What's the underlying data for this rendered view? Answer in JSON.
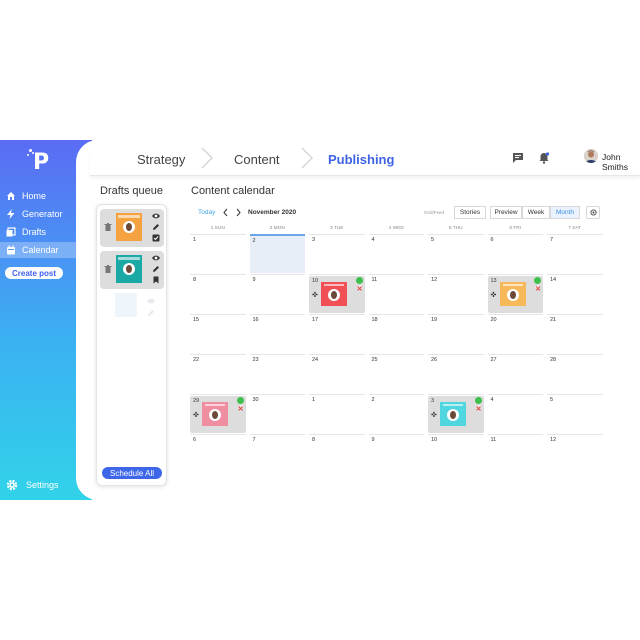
{
  "sidebar": {
    "items": [
      {
        "label": "Home",
        "icon": "home-icon"
      },
      {
        "label": "Generator",
        "icon": "bolt-icon"
      },
      {
        "label": "Drafts",
        "icon": "drafts-icon"
      },
      {
        "label": "Calendar",
        "icon": "calendar-icon"
      }
    ],
    "create_label": "Create post",
    "settings_label": "Settings",
    "active": "Calendar"
  },
  "header": {
    "breadcrumbs": [
      "Strategy",
      "Content",
      "Publishing"
    ],
    "active_crumb": "Publishing",
    "username": "John Smiths"
  },
  "drafts": {
    "title": "Drafts queue",
    "schedule_label": "Schedule All"
  },
  "calendar": {
    "title": "Content calendar",
    "today_label": "Today",
    "month": "November 2020",
    "filter_label": "Grid/Feed",
    "stories_label": "Stories",
    "views": [
      "Preview",
      "Week",
      "Month"
    ],
    "selected_view": "Month",
    "day_headers": [
      "1 SUN",
      "2 MON",
      "3 TUE",
      "4 WED",
      "5 THU",
      "6 FRI",
      "7 SAT"
    ],
    "weeks": [
      [
        "1",
        "2",
        "3",
        "4",
        "5",
        "6",
        "7"
      ],
      [
        "8",
        "9",
        "10",
        "11",
        "12",
        "13",
        "14"
      ],
      [
        "15",
        "16",
        "17",
        "18",
        "19",
        "20",
        "21"
      ],
      [
        "22",
        "23",
        "24",
        "25",
        "26",
        "27",
        "28"
      ],
      [
        "29",
        "30",
        "1",
        "2",
        "3",
        "4",
        "5"
      ],
      [
        "6",
        "7",
        "8",
        "9",
        "10",
        "11",
        "12"
      ]
    ]
  },
  "colors": {
    "accent": "#3f63e6",
    "post_red": "#ef4f55",
    "post_orange": "#f4a340",
    "post_teal": "#1aa9a5",
    "post_pink": "#ef8ea0",
    "post_cyan": "#4fd6df",
    "post_yellow": "#f7b85a"
  }
}
